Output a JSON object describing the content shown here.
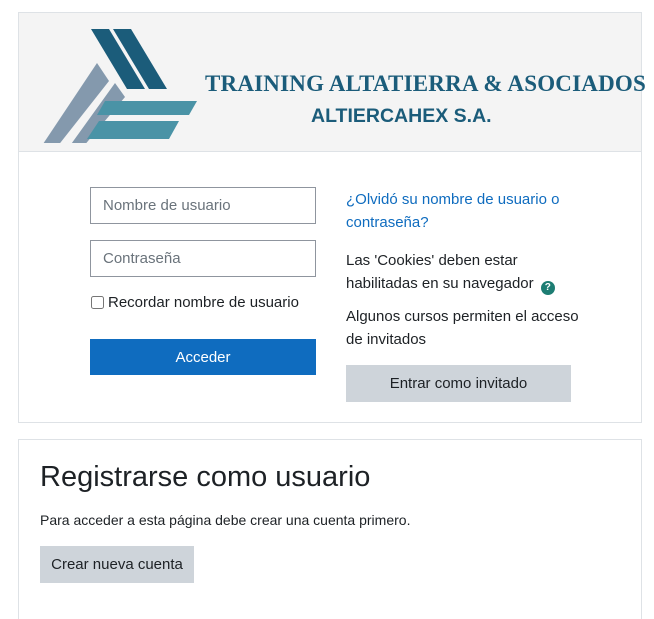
{
  "header": {
    "org_title": "TRAINING  ALTATIERRA & ASOCIADOS",
    "org_subtitle": "ALTIERCAHEX S.A.",
    "logo_icon": "triangle-stripes-logo",
    "colors": {
      "dark_blue": "#1b5c7a",
      "teal": "#4a93a6",
      "gray_blue": "#8499ad"
    }
  },
  "login": {
    "username_placeholder": "Nombre de usuario",
    "password_placeholder": "Contraseña",
    "remember_label": "Recordar nombre de usuario",
    "remember_checked": false,
    "submit_label": "Acceder",
    "forgot_link": "¿Olvidó su nombre de usuario o contraseña?",
    "cookies_text": "Las 'Cookies' deben estar habilitadas en su navegador",
    "cookies_help_icon": "question-circle-icon",
    "guest_text": "Algunos cursos permiten el acceso de invitados",
    "guest_button": "Entrar como invitado"
  },
  "signup": {
    "title": "Registrarse como usuario",
    "description": "Para acceder a esta página debe crear una cuenta primero.",
    "create_button": "Crear nueva cuenta"
  },
  "colors": {
    "primary": "#0f6cbf",
    "secondary": "#ced4da",
    "help_icon": "#1d7d73"
  }
}
